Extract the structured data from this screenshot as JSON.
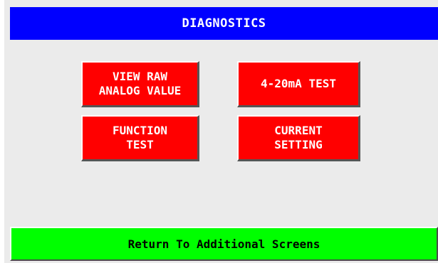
{
  "header": {
    "title": "DIAGNOSTICS"
  },
  "buttons": {
    "view_raw": "VIEW RAW\nANALOG VALUE",
    "test_4_20": "4-20mA TEST",
    "function_test": "FUNCTION\nTEST",
    "current_setting": "CURRENT\nSETTING"
  },
  "footer": {
    "return_label": "Return To Additional Screens"
  },
  "colors": {
    "title_bg": "#0000ff",
    "button_bg": "#ff0000",
    "return_bg": "#00ff00",
    "screen_bg": "#ebebeb"
  }
}
